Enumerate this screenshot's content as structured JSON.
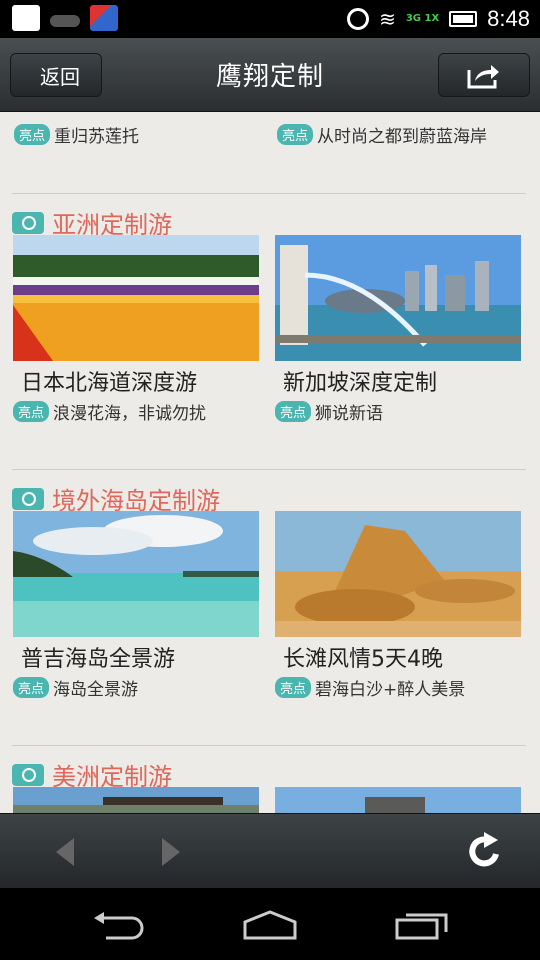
{
  "status_bar": {
    "time": "8:48",
    "network": "3G 1X",
    "icons": [
      "notification-icon",
      "wifi-icon",
      "alarm-icon",
      "battery-icon"
    ]
  },
  "header": {
    "back_label": "返回",
    "title": "鹰翔定制",
    "share_icon": "share-icon"
  },
  "top_partial": {
    "left_tag": "亮点",
    "left_desc": "重归苏莲托",
    "right_tag": "亮点",
    "right_desc": "从时尚之都到蔚蓝海岸"
  },
  "sections": [
    {
      "title": "亚洲定制游",
      "cards": [
        {
          "title": "日本北海道深度游",
          "tag": "亮点",
          "desc": "浪漫花海，非诚勿扰"
        },
        {
          "title": "新加坡深度定制",
          "tag": "亮点",
          "desc": "狮说新语"
        }
      ]
    },
    {
      "title": "境外海岛定制游",
      "cards": [
        {
          "title": "普吉海岛全景游",
          "tag": "亮点",
          "desc": "海岛全景游"
        },
        {
          "title": "长滩风情5天4晚",
          "tag": "亮点",
          "desc": "碧海白沙+醉人美景"
        }
      ]
    },
    {
      "title": "美洲定制游",
      "cards": []
    }
  ],
  "colors": {
    "accent_teal": "#4bb5b0",
    "section_title": "#e0675a",
    "content_bg": "#ecebe8"
  }
}
